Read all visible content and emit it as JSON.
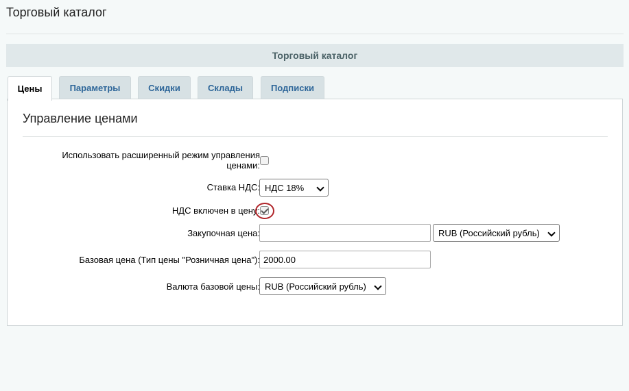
{
  "page": {
    "title": "Торговый каталог"
  },
  "section": {
    "title": "Торговый каталог"
  },
  "tabs": [
    {
      "label": "Цены",
      "active": true
    },
    {
      "label": "Параметры",
      "active": false
    },
    {
      "label": "Скидки",
      "active": false
    },
    {
      "label": "Склады",
      "active": false
    },
    {
      "label": "Подписки",
      "active": false
    }
  ],
  "panel": {
    "heading": "Управление ценами",
    "fields": {
      "extended_mode": {
        "label_line1": "Использовать расширенный режим управления",
        "label_line2": "ценами:",
        "checked": false
      },
      "vat_rate": {
        "label": "Ставка НДС:",
        "value": "НДС 18%"
      },
      "vat_included": {
        "label": "НДС включен в цену:",
        "checked": true
      },
      "purchase_price": {
        "label": "Закупочная цена:",
        "value": "",
        "currency": "RUB (Российский рубль)"
      },
      "base_price": {
        "label": "Базовая цена (Тип цены \"Розничная цена\"):",
        "value": "2000.00"
      },
      "base_currency": {
        "label": "Валюта базовой цены:",
        "value": "RUB (Российский рубль)"
      }
    }
  },
  "colors": {
    "highlight": "#b0252a",
    "tab_text": "#2e6699"
  }
}
